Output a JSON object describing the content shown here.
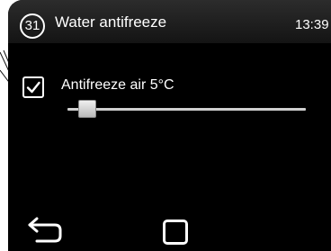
{
  "header": {
    "page_number": "31",
    "title": "Water antifreeze",
    "clock": "13:39"
  },
  "setting": {
    "checked": true,
    "label": "Antifreeze air 5°C",
    "slider_fraction": 0.05
  },
  "nav": {
    "back_icon": "back-arrow-icon",
    "home_icon": "square-home-icon"
  },
  "colors": {
    "screen_background": "#000000",
    "foreground": "#ffffff"
  }
}
